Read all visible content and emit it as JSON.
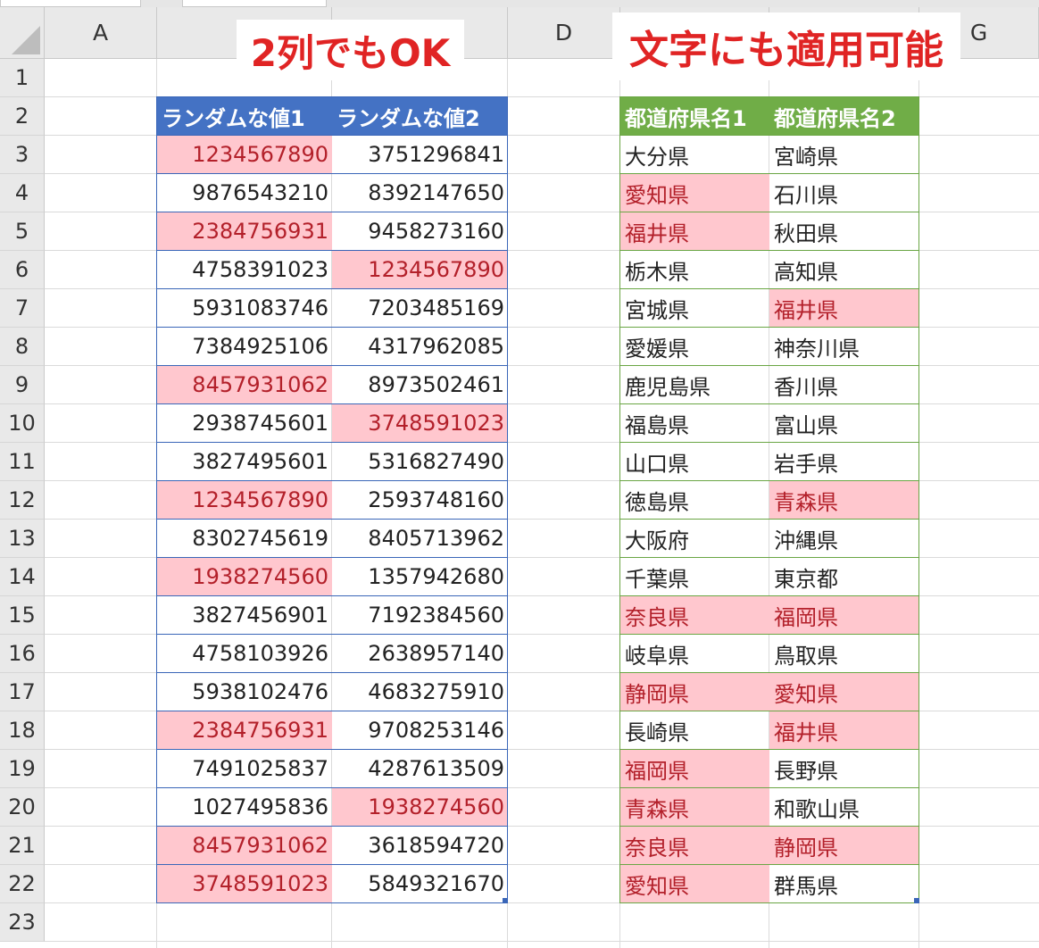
{
  "columns": [
    "A",
    "",
    "",
    "D",
    "",
    "",
    "G"
  ],
  "rows": [
    "1",
    "2",
    "3",
    "4",
    "5",
    "6",
    "7",
    "8",
    "9",
    "10",
    "11",
    "12",
    "13",
    "14",
    "15",
    "16",
    "17",
    "18",
    "19",
    "20",
    "21",
    "22",
    "23"
  ],
  "callouts": {
    "numbers": "2列でもOK",
    "text": "文字にも適用可能"
  },
  "colors": {
    "numbers_header_bg": "#4472c4",
    "prefecture_header_bg": "#70ad47",
    "duplicate_fill": "#ffc7ce",
    "duplicate_text": "#9c0006",
    "callout_text": "#e02424"
  },
  "numbers_table": {
    "headers": [
      "ランダムな値1",
      "ランダムな値2"
    ],
    "rows": [
      {
        "v1": "1234567890",
        "v2": "3751296841",
        "h1": true,
        "h2": false
      },
      {
        "v1": "9876543210",
        "v2": "8392147650",
        "h1": false,
        "h2": false
      },
      {
        "v1": "2384756931",
        "v2": "9458273160",
        "h1": true,
        "h2": false
      },
      {
        "v1": "4758391023",
        "v2": "1234567890",
        "h1": false,
        "h2": true
      },
      {
        "v1": "5931083746",
        "v2": "7203485169",
        "h1": false,
        "h2": false
      },
      {
        "v1": "7384925106",
        "v2": "4317962085",
        "h1": false,
        "h2": false
      },
      {
        "v1": "8457931062",
        "v2": "8973502461",
        "h1": true,
        "h2": false
      },
      {
        "v1": "2938745601",
        "v2": "3748591023",
        "h1": false,
        "h2": true
      },
      {
        "v1": "3827495601",
        "v2": "5316827490",
        "h1": false,
        "h2": false
      },
      {
        "v1": "1234567890",
        "v2": "2593748160",
        "h1": true,
        "h2": false
      },
      {
        "v1": "8302745619",
        "v2": "8405713962",
        "h1": false,
        "h2": false
      },
      {
        "v1": "1938274560",
        "v2": "1357942680",
        "h1": true,
        "h2": false
      },
      {
        "v1": "3827456901",
        "v2": "7192384560",
        "h1": false,
        "h2": false
      },
      {
        "v1": "4758103926",
        "v2": "2638957140",
        "h1": false,
        "h2": false
      },
      {
        "v1": "5938102476",
        "v2": "4683275910",
        "h1": false,
        "h2": false
      },
      {
        "v1": "2384756931",
        "v2": "9708253146",
        "h1": true,
        "h2": false
      },
      {
        "v1": "7491025837",
        "v2": "4287613509",
        "h1": false,
        "h2": false
      },
      {
        "v1": "1027495836",
        "v2": "1938274560",
        "h1": false,
        "h2": true
      },
      {
        "v1": "8457931062",
        "v2": "3618594720",
        "h1": true,
        "h2": false
      },
      {
        "v1": "3748591023",
        "v2": "5849321670",
        "h1": true,
        "h2": false
      }
    ]
  },
  "prefecture_table": {
    "headers": [
      "都道府県名1",
      "都道府県名2"
    ],
    "rows": [
      {
        "v1": "大分県",
        "v2": "宮崎県",
        "h1": false,
        "h2": false
      },
      {
        "v1": "愛知県",
        "v2": "石川県",
        "h1": true,
        "h2": false
      },
      {
        "v1": "福井県",
        "v2": "秋田県",
        "h1": true,
        "h2": false
      },
      {
        "v1": "栃木県",
        "v2": "高知県",
        "h1": false,
        "h2": false
      },
      {
        "v1": "宮城県",
        "v2": "福井県",
        "h1": false,
        "h2": true
      },
      {
        "v1": "愛媛県",
        "v2": "神奈川県",
        "h1": false,
        "h2": false
      },
      {
        "v1": "鹿児島県",
        "v2": "香川県",
        "h1": false,
        "h2": false
      },
      {
        "v1": "福島県",
        "v2": "富山県",
        "h1": false,
        "h2": false
      },
      {
        "v1": "山口県",
        "v2": "岩手県",
        "h1": false,
        "h2": false
      },
      {
        "v1": "徳島県",
        "v2": "青森県",
        "h1": false,
        "h2": true
      },
      {
        "v1": "大阪府",
        "v2": "沖縄県",
        "h1": false,
        "h2": false
      },
      {
        "v1": "千葉県",
        "v2": "東京都",
        "h1": false,
        "h2": false
      },
      {
        "v1": "奈良県",
        "v2": "福岡県",
        "h1": true,
        "h2": true
      },
      {
        "v1": "岐阜県",
        "v2": "鳥取県",
        "h1": false,
        "h2": false
      },
      {
        "v1": "静岡県",
        "v2": "愛知県",
        "h1": true,
        "h2": true
      },
      {
        "v1": "長崎県",
        "v2": "福井県",
        "h1": false,
        "h2": true
      },
      {
        "v1": "福岡県",
        "v2": "長野県",
        "h1": true,
        "h2": false
      },
      {
        "v1": "青森県",
        "v2": "和歌山県",
        "h1": true,
        "h2": false
      },
      {
        "v1": "奈良県",
        "v2": "静岡県",
        "h1": true,
        "h2": true
      },
      {
        "v1": "愛知県",
        "v2": "群馬県",
        "h1": true,
        "h2": false
      }
    ]
  }
}
